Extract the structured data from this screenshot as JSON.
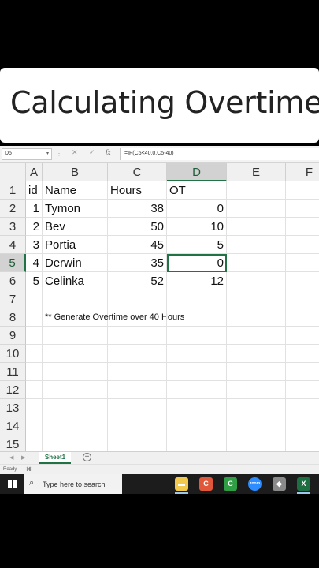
{
  "title_card": {
    "title": "Calculating Overtime"
  },
  "formula_bar": {
    "name_box": "D5",
    "formula": "=IF(C5<40,0,C5-40)",
    "fx_label": "fx"
  },
  "columns": [
    "A",
    "B",
    "C",
    "D",
    "E",
    "F"
  ],
  "active_column": "D",
  "active_row": "5",
  "rows": [
    {
      "num": "1",
      "a": "id",
      "b": "Name",
      "c": "Hours",
      "d": "OT"
    },
    {
      "num": "2",
      "a": "1",
      "b": "Tymon",
      "c": "38",
      "d": "0"
    },
    {
      "num": "3",
      "a": "2",
      "b": "Bev",
      "c": "50",
      "d": "10"
    },
    {
      "num": "4",
      "a": "3",
      "b": "Portia",
      "c": "45",
      "d": "5"
    },
    {
      "num": "5",
      "a": "4",
      "b": "Derwin",
      "c": "35",
      "d": "0"
    },
    {
      "num": "6",
      "a": "5",
      "b": "Celinka",
      "c": "52",
      "d": "12"
    },
    {
      "num": "7"
    },
    {
      "num": "8",
      "note": "** Generate Overtime over 40 Hours"
    },
    {
      "num": "9"
    },
    {
      "num": "10"
    },
    {
      "num": "11"
    },
    {
      "num": "12"
    },
    {
      "num": "13"
    },
    {
      "num": "14"
    },
    {
      "num": "15"
    }
  ],
  "sheet_tabs": {
    "active": "Sheet1",
    "add_label": "+"
  },
  "status": {
    "text": "Ready"
  },
  "taskbar": {
    "search_placeholder": "Type here to search",
    "apps": [
      {
        "name": "file-explorer",
        "color": "#f2c94c",
        "glyph": "▬"
      },
      {
        "name": "app-red-c",
        "color": "#e0573a",
        "glyph": "C"
      },
      {
        "name": "app-green-c",
        "color": "#2f9e44",
        "glyph": "C"
      },
      {
        "name": "zoom",
        "color": "#2d8cff",
        "glyph": "zoom"
      },
      {
        "name": "app-misc",
        "color": "#8a8a8a",
        "glyph": "◆"
      },
      {
        "name": "excel",
        "color": "#1d6f42",
        "glyph": "X"
      }
    ]
  }
}
